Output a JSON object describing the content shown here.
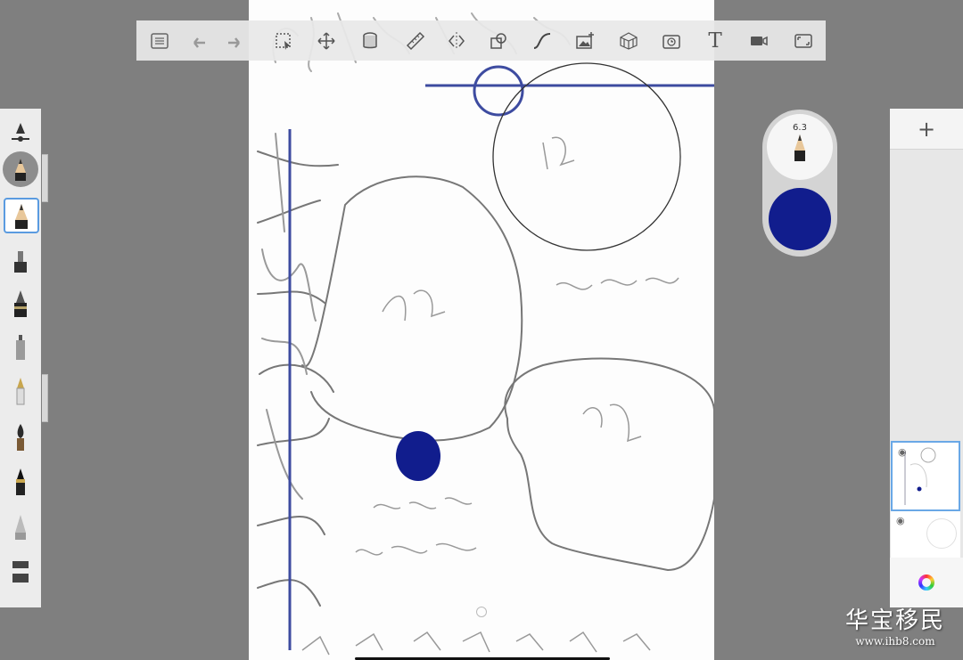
{
  "toolbar": {
    "tools": [
      "list-icon",
      "undo-icon",
      "redo-icon",
      "selection-icon",
      "transform-icon",
      "fill-icon",
      "ruler-icon",
      "symmetry-icon",
      "shape-icon",
      "curve-icon",
      "image-import-icon",
      "perspective-icon",
      "time-lapse-icon",
      "text-icon",
      "video-icon",
      "fullscreen-icon"
    ],
    "text_tool_glyph": "T"
  },
  "brush": {
    "size": "6.3",
    "color": "#111d8d"
  },
  "left_tools": [
    "pencil",
    "pencil-selected",
    "marker",
    "fineliner",
    "airbrush",
    "fountain-pen",
    "ink-brush",
    "paint-brush",
    "smudge",
    "eraser"
  ],
  "layers": {
    "add_label": "+"
  },
  "accent": "#5a9be0",
  "watermark": {
    "title": "华宝移民",
    "url": "www.ihb8.com"
  }
}
